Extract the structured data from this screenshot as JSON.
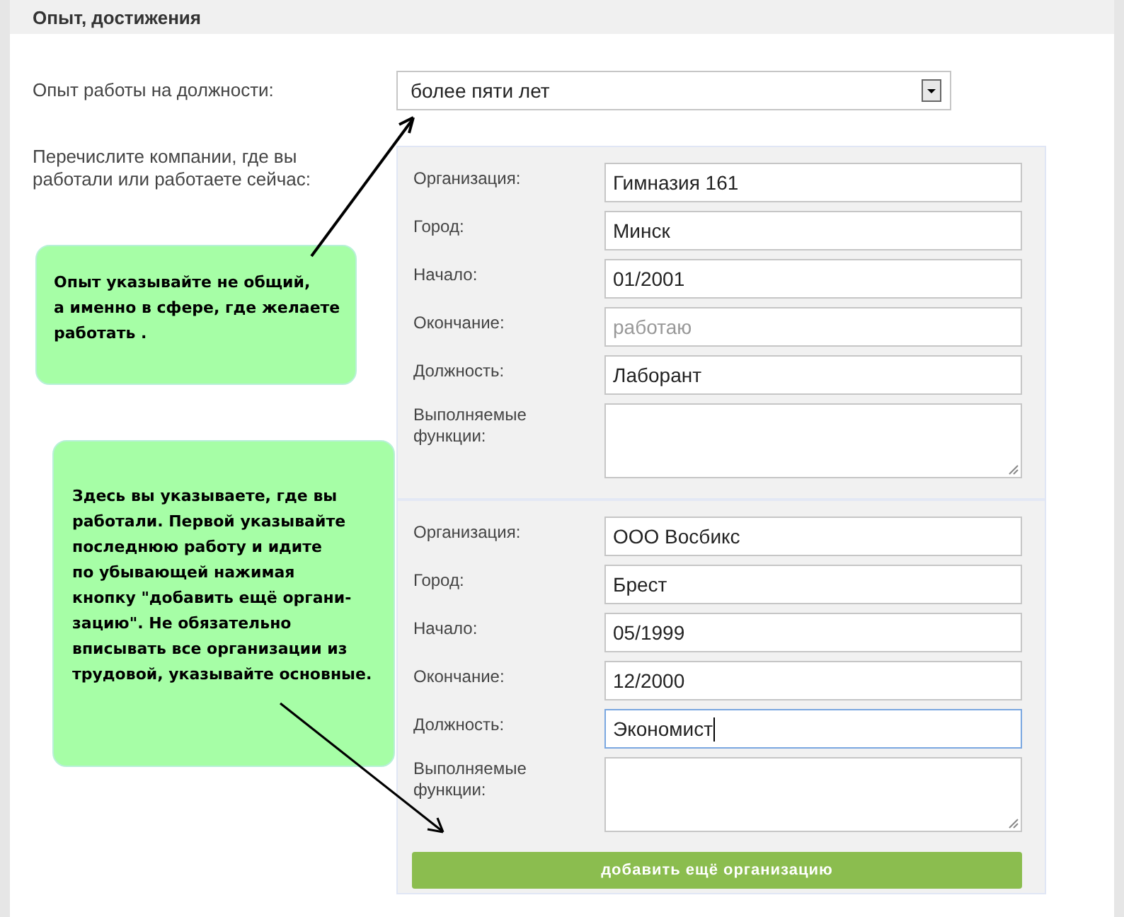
{
  "section_title": "Опыт, достижения",
  "experience": {
    "label": "Опыт работы на должности:",
    "value": "более пяти лет"
  },
  "companies_label": "Перечислите компании, где вы работали или работаете сейчас:",
  "companies": [
    {
      "fields": [
        {
          "kind": "input",
          "label": "Организация:",
          "value": "Гимназия 161",
          "focused": false
        },
        {
          "kind": "input",
          "label": "Город:",
          "value": "Минск",
          "focused": false
        },
        {
          "kind": "input",
          "label": "Начало:",
          "value": "01/2001",
          "focused": false
        },
        {
          "kind": "input",
          "label": "Окончание:",
          "placeholder": "работаю",
          "focused": false
        },
        {
          "kind": "input",
          "label": "Должность:",
          "value": "Лаборант",
          "focused": false
        },
        {
          "kind": "textarea",
          "label": "Выполняемые функции:"
        }
      ]
    },
    {
      "fields": [
        {
          "kind": "input",
          "label": "Организация:",
          "value": "ООО Восбикс",
          "focused": false
        },
        {
          "kind": "input",
          "label": "Город:",
          "value": "Брест",
          "focused": false
        },
        {
          "kind": "input",
          "label": "Начало:",
          "value": "05/1999",
          "focused": false
        },
        {
          "kind": "input",
          "label": "Окончание:",
          "value": "12/2000",
          "focused": false
        },
        {
          "kind": "input",
          "label": "Должность:",
          "value": "Экономист",
          "focused": true
        },
        {
          "kind": "textarea",
          "label": "Выполняемые функции:"
        }
      ]
    }
  ],
  "add_button": "добавить ещё организацию",
  "notes": [
    "Опыт указывайте не общий,\nа именно в сфере, где желаете\nработать .",
    "Здесь вы указываете, где вы\nработали. Первой указывайте\nпоследнюю работу и идите\nпо убывающей нажимая\nкнопку \"добавить ещё органи-\nзацию\". Не обязательно\nвписывать все организации из\nтрудовой, указывайте основные."
  ]
}
